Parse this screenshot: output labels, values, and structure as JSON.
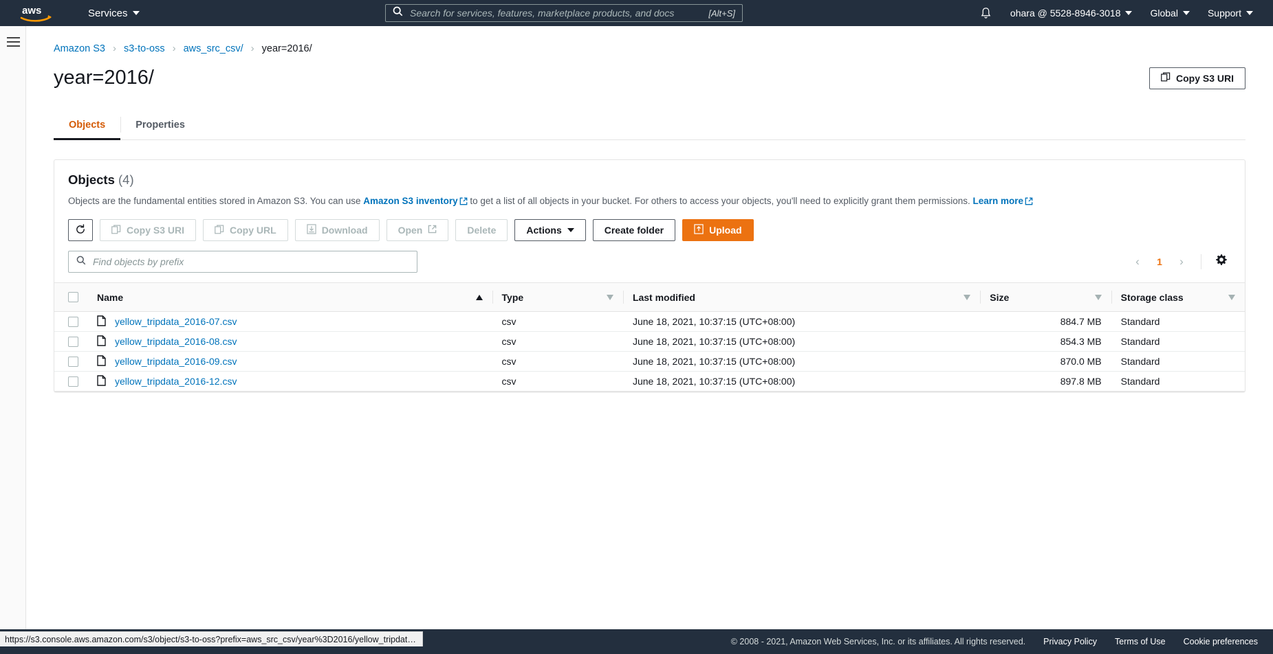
{
  "topnav": {
    "logo_alt": "aws",
    "services_label": "Services",
    "search": {
      "placeholder": "Search for services, features, marketplace products, and docs",
      "value": "",
      "shortcut": "[Alt+S]"
    },
    "account_label": "ohara @ 5528-8946-3018",
    "region_label": "Global",
    "support_label": "Support"
  },
  "breadcrumb": [
    {
      "label": "Amazon S3",
      "current": false
    },
    {
      "label": "s3-to-oss",
      "current": false
    },
    {
      "label": "aws_src_csv/",
      "current": false
    },
    {
      "label": "year=2016/",
      "current": true
    }
  ],
  "page": {
    "title": "year=2016/",
    "copy_s3_uri_label": "Copy S3 URI"
  },
  "tabs": [
    {
      "label": "Objects",
      "active": true
    },
    {
      "label": "Properties",
      "active": false
    }
  ],
  "objects_card": {
    "title": "Objects",
    "count": "(4)",
    "description_part1": "Objects are the fundamental entities stored in Amazon S3. You can use",
    "inventory_link": "Amazon S3 inventory",
    "description_part2": "to get a list of all objects in your bucket. For others to access your objects, you'll need to explicitly grant them permissions.",
    "learn_more_link": "Learn more",
    "toolbar": {
      "refresh_label": "",
      "copy_s3_uri_label": "Copy S3 URI",
      "copy_url_label": "Copy URL",
      "download_label": "Download",
      "open_label": "Open",
      "delete_label": "Delete",
      "actions_label": "Actions",
      "create_folder_label": "Create folder",
      "upload_label": "Upload"
    },
    "search": {
      "placeholder": "Find objects by prefix",
      "value": ""
    },
    "pagination": {
      "prev": "‹",
      "page": "1",
      "next": "›"
    },
    "columns": [
      {
        "label": "Name",
        "sort": "asc"
      },
      {
        "label": "Type",
        "sort": "none"
      },
      {
        "label": "Last modified",
        "sort": "none"
      },
      {
        "label": "Size",
        "sort": "none"
      },
      {
        "label": "Storage class",
        "sort": "none"
      }
    ],
    "rows": [
      {
        "name": "yellow_tripdata_2016-07.csv",
        "type": "csv",
        "last_modified": "June 18, 2021, 10:37:15 (UTC+08:00)",
        "size": "884.7 MB",
        "storage_class": "Standard"
      },
      {
        "name": "yellow_tripdata_2016-08.csv",
        "type": "csv",
        "last_modified": "June 18, 2021, 10:37:15 (UTC+08:00)",
        "size": "854.3 MB",
        "storage_class": "Standard"
      },
      {
        "name": "yellow_tripdata_2016-09.csv",
        "type": "csv",
        "last_modified": "June 18, 2021, 10:37:15 (UTC+08:00)",
        "size": "870.0 MB",
        "storage_class": "Standard"
      },
      {
        "name": "yellow_tripdata_2016-12.csv",
        "type": "csv",
        "last_modified": "June 18, 2021, 10:37:15 (UTC+08:00)",
        "size": "897.8 MB",
        "storage_class": "Standard"
      }
    ]
  },
  "statusbar": {
    "url": "https://s3.console.aws.amazon.com/s3/object/s3-to-oss?prefix=aws_src_csv/year%3D2016/yellow_tripdata_…"
  },
  "footer": {
    "copyright": "© 2008 - 2021, Amazon Web Services, Inc. or its affiliates. All rights reserved.",
    "privacy_label": "Privacy Policy",
    "terms_label": "Terms of Use",
    "cookie_label": "Cookie preferences"
  },
  "colors": {
    "nav_bg": "#232f3e",
    "accent_orange": "#ec7211",
    "link_blue": "#0073bb"
  }
}
